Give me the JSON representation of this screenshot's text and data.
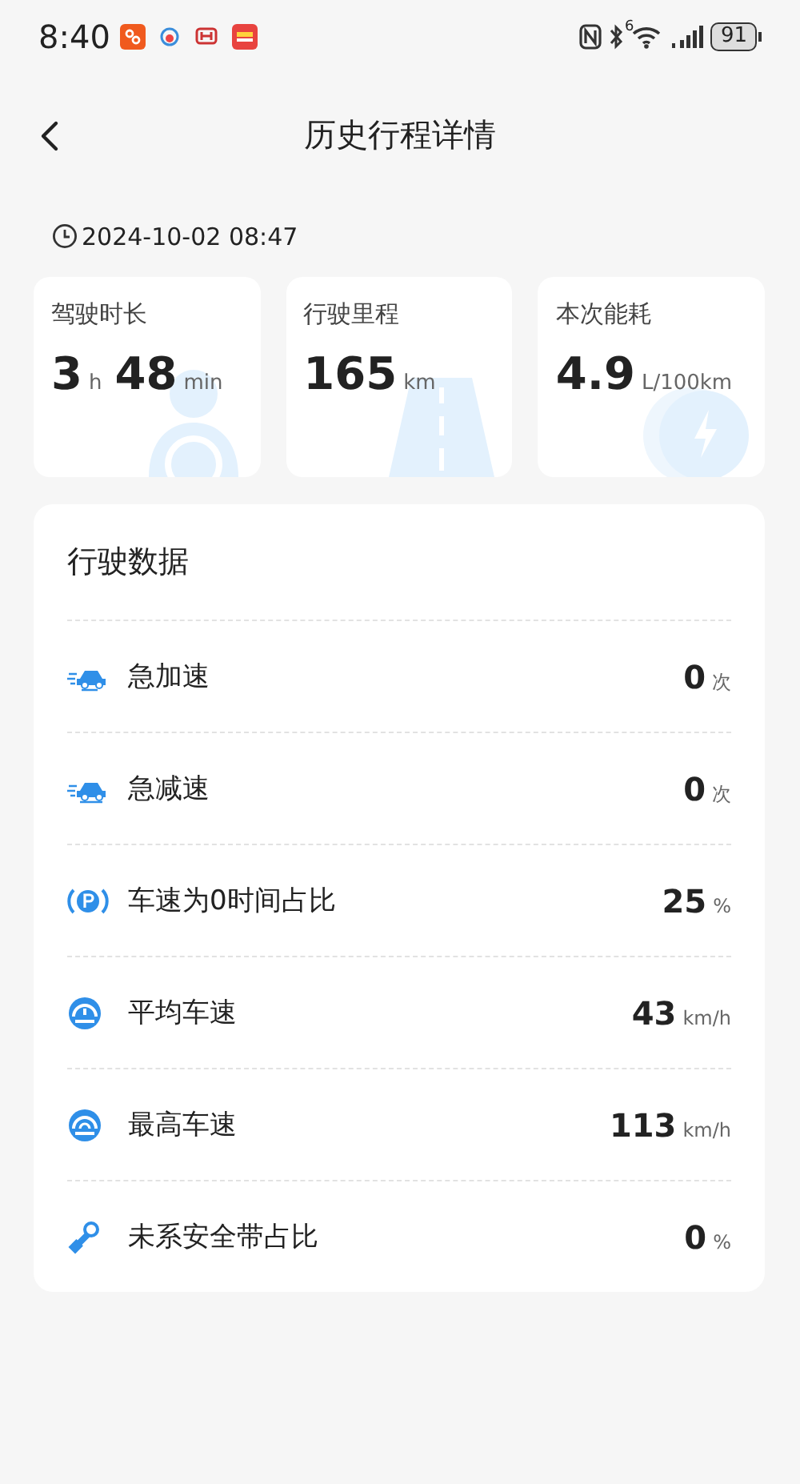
{
  "status_bar": {
    "time": "8:40",
    "wifi_badge": "6",
    "battery": "91"
  },
  "header": {
    "title": "历史行程详情"
  },
  "trip_time": "2024-10-02 08:47",
  "summary_cards": [
    {
      "kind": "duration",
      "label": "驾驶时长",
      "parts": [
        {
          "value": "3",
          "unit": "h"
        },
        {
          "value": "48",
          "unit": "min"
        }
      ]
    },
    {
      "kind": "distance",
      "label": "行驶里程",
      "parts": [
        {
          "value": "165",
          "unit": "km"
        }
      ]
    },
    {
      "kind": "energy",
      "label": "本次能耗",
      "parts": [
        {
          "value": "4.9",
          "unit": "L/100km"
        }
      ]
    }
  ],
  "driving_data": {
    "title": "行驶数据",
    "rows": [
      {
        "kind": "accel",
        "label": "急加速",
        "value": "0",
        "unit": "次"
      },
      {
        "kind": "decel",
        "label": "急减速",
        "value": "0",
        "unit": "次"
      },
      {
        "kind": "parking",
        "label": "车速为0时间占比",
        "value": "25",
        "unit": "%"
      },
      {
        "kind": "avg-speed",
        "label": "平均车速",
        "value": "43",
        "unit": "km/h"
      },
      {
        "kind": "max-speed",
        "label": "最高车速",
        "value": "113",
        "unit": "km/h"
      },
      {
        "kind": "seatbelt",
        "label": "未系安全带占比",
        "value": "0",
        "unit": "%"
      }
    ]
  }
}
